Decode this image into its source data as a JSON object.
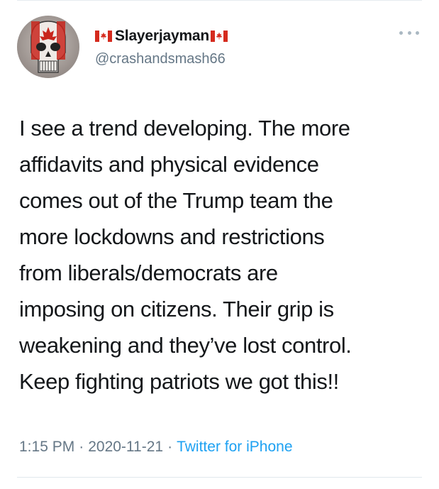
{
  "user": {
    "display_name": "Slayerjayman",
    "handle": "@crashandsmash66",
    "flag_icon": "canada-flag-icon",
    "avatar_icon": "punisher-skull-canada-flag-avatar"
  },
  "menu": {
    "icon": "more-options-icon"
  },
  "tweet": {
    "lines": [
      "I see a trend developing. The more",
      "affidavits and physical evidence",
      "comes out of the Trump team the",
      "more lockdowns and restrictions",
      "from liberals/democrats are",
      "imposing on citizens. Their grip is",
      "weakening and they’ve lost control.",
      "Keep fighting patriots we got this!!"
    ]
  },
  "meta": {
    "time": "1:15 PM",
    "separator": "·",
    "date": "2020-11-21",
    "source": "Twitter for iPhone"
  },
  "colors": {
    "text": "#14171a",
    "secondary": "#657786",
    "link": "#1da1f2",
    "flag_red": "#d52b1e"
  }
}
